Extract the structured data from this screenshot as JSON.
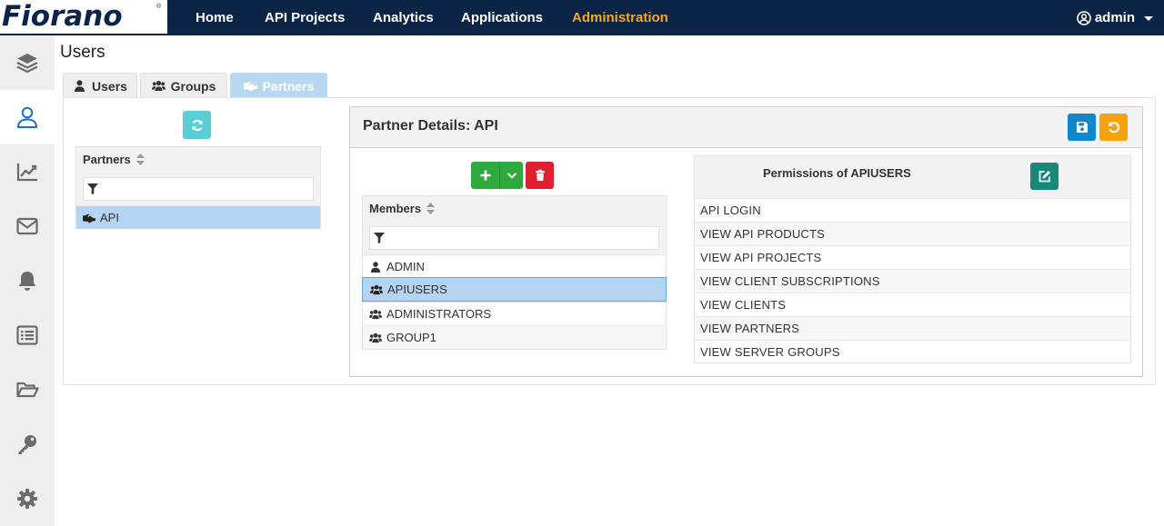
{
  "brand": {
    "logo_text": "Fiorano",
    "logo_reg": "®"
  },
  "nav": {
    "items": [
      {
        "label": "Home"
      },
      {
        "label": "API Projects"
      },
      {
        "label": "Analytics"
      },
      {
        "label": "Applications"
      },
      {
        "label": "Administration",
        "active": true
      }
    ],
    "user": "admin"
  },
  "sidebar": {
    "items": [
      {
        "icon": "layers-icon"
      },
      {
        "icon": "user-icon",
        "active": true
      },
      {
        "icon": "chart-icon"
      },
      {
        "icon": "envelope-icon"
      },
      {
        "icon": "bell-icon"
      },
      {
        "icon": "list-icon"
      },
      {
        "icon": "folder-open-icon"
      },
      {
        "icon": "key-icon"
      },
      {
        "icon": "gear-icon"
      }
    ]
  },
  "page": {
    "title": "Users"
  },
  "tabs": [
    {
      "label": "Users",
      "icon": "user-icon"
    },
    {
      "label": "Groups",
      "icon": "users-icon"
    },
    {
      "label": "Partners",
      "icon": "handshake-icon",
      "active": true
    }
  ],
  "partners": {
    "header": "Partners",
    "filter_value": "",
    "items": [
      {
        "label": "API",
        "selected": true
      }
    ]
  },
  "details": {
    "title": "Partner Details: API",
    "members": {
      "header": "Members",
      "filter_value": "",
      "items": [
        {
          "label": "ADMIN",
          "type": "user"
        },
        {
          "label": "APIUSERS",
          "type": "group",
          "selected": true
        },
        {
          "label": "ADMINISTRATORS",
          "type": "group"
        },
        {
          "label": "GROUP1",
          "type": "group"
        }
      ]
    },
    "permissions": {
      "title": "Permissions of APIUSERS",
      "items": [
        "API LOGIN",
        "VIEW API PRODUCTS",
        "VIEW API PROJECTS",
        "VIEW CLIENT SUBSCRIPTIONS",
        "VIEW CLIENTS",
        "VIEW PARTNERS",
        "VIEW SERVER GROUPS"
      ]
    }
  },
  "colors": {
    "nav_bg": "#0c2546",
    "nav_active": "#f5a623",
    "add_green": "#2eaa3c",
    "delete_red": "#e02031",
    "save_blue": "#1188c9",
    "revert_orange": "#f5a20c",
    "edit_teal": "#17897a",
    "refresh_teal": "#5bcdd6",
    "selected_row": "#b4d4f2"
  }
}
